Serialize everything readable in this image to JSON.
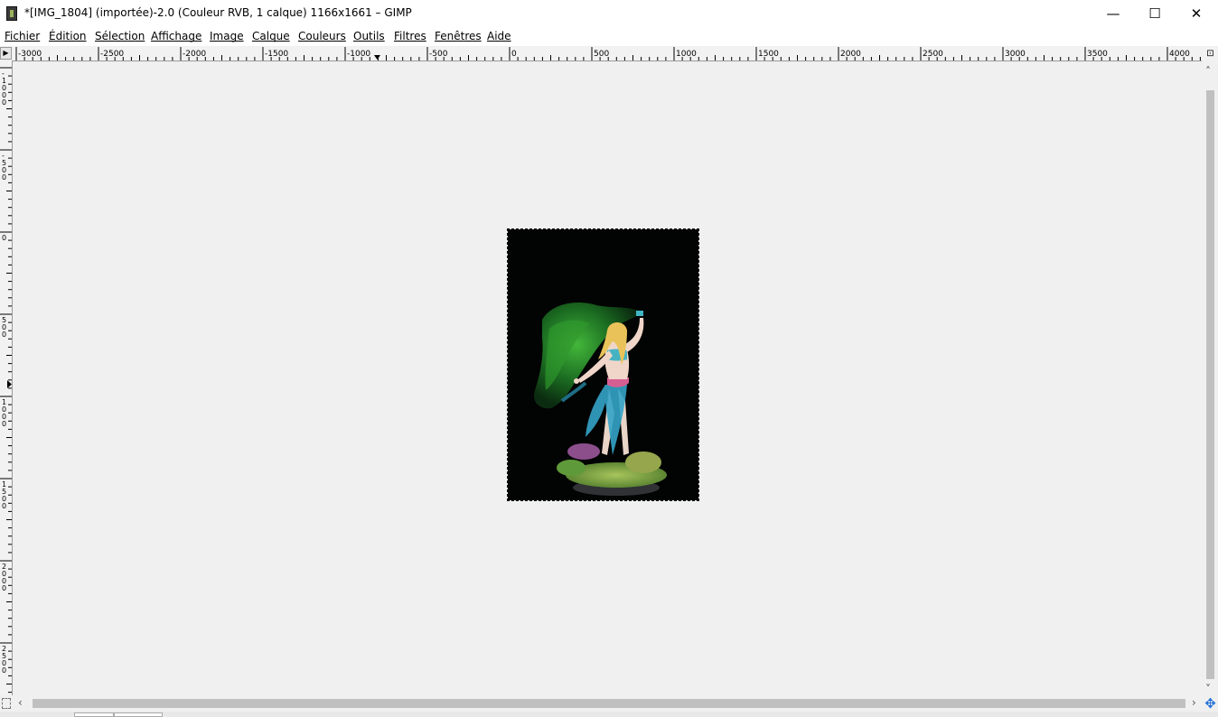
{
  "window": {
    "title": "*[IMG_1804] (importée)-2.0 (Couleur RVB, 1 calque) 1166x1661 – GIMP",
    "minimize_glyph": "—",
    "maximize_glyph": "☐",
    "close_glyph": "✕"
  },
  "menu": {
    "items": [
      {
        "label": "Fichier"
      },
      {
        "label": "Édition"
      },
      {
        "label": "Sélection"
      },
      {
        "label": "Affichage"
      },
      {
        "label": "Image"
      },
      {
        "label": "Calque"
      },
      {
        "label": "Couleurs"
      },
      {
        "label": "Outils"
      },
      {
        "label": "Filtres"
      },
      {
        "label": "Fenêtres"
      },
      {
        "label": "Aide"
      }
    ]
  },
  "rulers": {
    "horizontal_labels": [
      "-3000",
      "-2500",
      "-2000",
      "-1500",
      "-1000",
      "-500",
      "0",
      "500",
      "1000",
      "1500",
      "2000",
      "2500",
      "3000",
      "3500",
      "4000"
    ],
    "vertical_labels": [
      "-1000",
      "-500",
      "0",
      "500",
      "1000",
      "1500",
      "2000",
      "2500"
    ]
  },
  "icons": {
    "ruler_corner": "menu-triangle-icon",
    "zoom_corner": "zoom-fit-icon",
    "quick_mask": "quick-mask-icon",
    "navigate": "navigate-icon"
  },
  "colors": {
    "canvas_bg": "#f0f0f0",
    "image_bg": "#000000",
    "nav_icon": "#1f6fd6"
  }
}
